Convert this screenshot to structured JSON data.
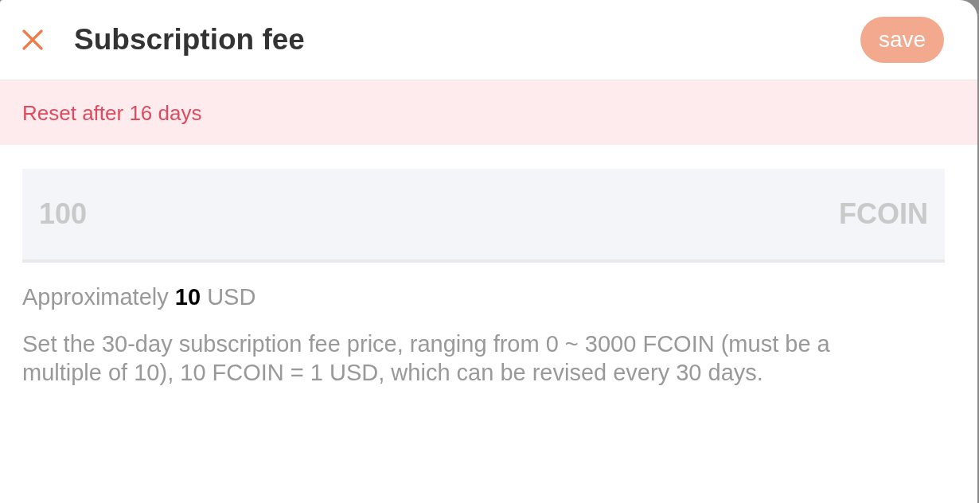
{
  "dialog": {
    "title": "Subscription fee",
    "save_button": {
      "label": "save",
      "disabled": true
    }
  },
  "notice": "Reset after 16 days",
  "fee_field": {
    "value": "100",
    "unit": "FCOIN",
    "disabled": true
  },
  "approximation": "Approximately **10** USD",
  "description": "Set the 30-day subscription fee price, ranging from 0 ~ 3000 FCOIN (must be a multiple of 10), 10 FCOIN = 1 USD, which can be revised every 30 days."
}
